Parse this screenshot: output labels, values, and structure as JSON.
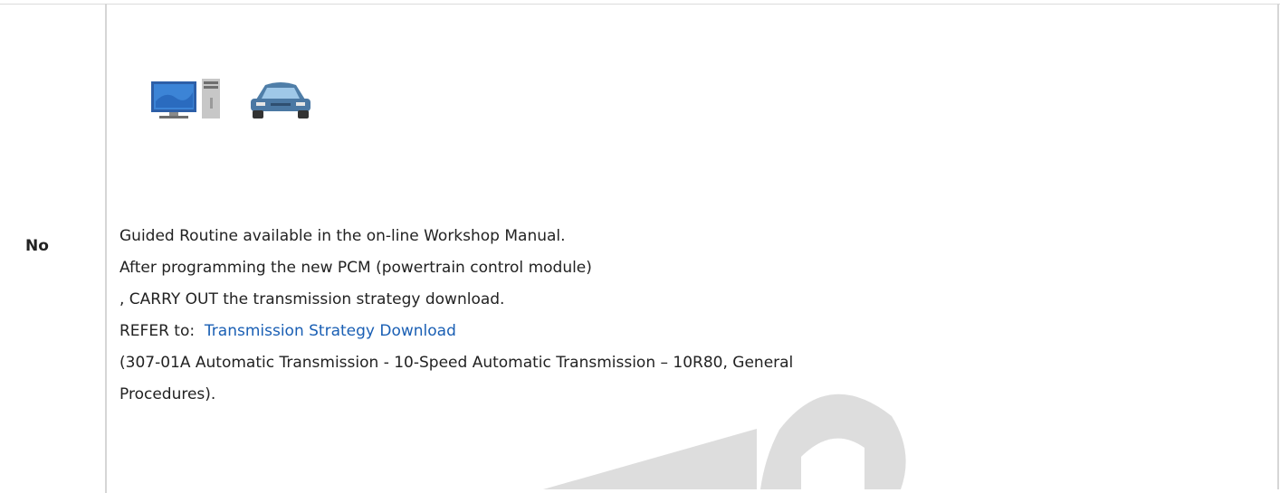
{
  "row": {
    "label": "No",
    "icons": [
      "computer-icon",
      "car-icon"
    ],
    "lines": [
      "Guided Routine available in the on-line Workshop Manual.",
      " After programming the new PCM (powertrain control module)",
      ", CARRY OUT the transmission strategy download."
    ],
    "refer_prefix": " REFER to:",
    "refer_link": "Transmission Strategy Download",
    "reference_line1": "(307-01A Automatic Transmission - 10-Speed Automatic Transmission – 10R80, General",
    "reference_line2": "Procedures)."
  },
  "colors": {
    "link": "#1a5fb4",
    "border": "#d6d6d6",
    "watermark": "#d9d9d9"
  }
}
